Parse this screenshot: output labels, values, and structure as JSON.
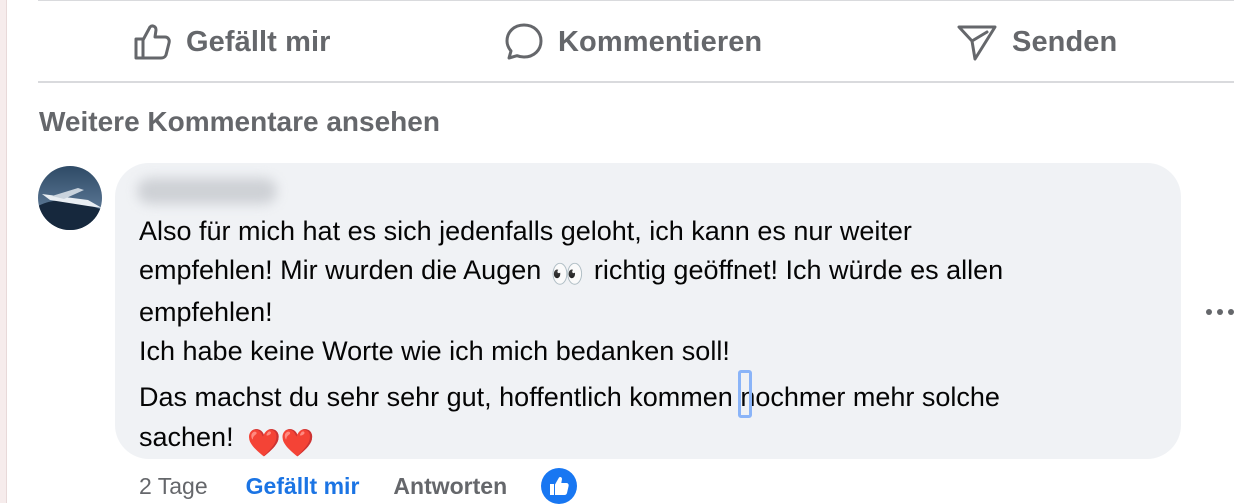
{
  "actions": {
    "like_label": "Gefällt mir",
    "comment_label": "Kommentieren",
    "send_label": "Senden"
  },
  "more_comments_label": "Weitere Kommentare ansehen",
  "comment": {
    "author_name": "",
    "lines": [
      "Also für mich hat es sich jedenfalls geloht, ich kann es nur weiter",
      "empfehlen! Mir wurden die Augen",
      "richtig geöffnet! Ich würde es allen",
      "empfehlen!",
      "Ich habe keine Worte wie ich mich bedanken soll!",
      "Das machst du sehr sehr gut, hoffentlich kommen",
      "nochmer mehr solche",
      "sachen!"
    ],
    "emoji_eyes": "👀",
    "emoji_hearts": "❤️❤️",
    "time": "2 Tage",
    "like_label": "Gefällt mir",
    "reply_label": "Antworten"
  },
  "colors": {
    "secondary_text": "#65676b",
    "link_blue": "#1b74e4",
    "bubble_bg": "#f0f2f5",
    "reaction_blue": "#1877f2"
  },
  "icons": {
    "like": "thumbs-up-outline-icon",
    "comment": "speech-bubble-icon",
    "send": "paper-plane-icon",
    "more": "ellipsis-icon",
    "reaction": "thumbs-up-reaction-icon"
  }
}
